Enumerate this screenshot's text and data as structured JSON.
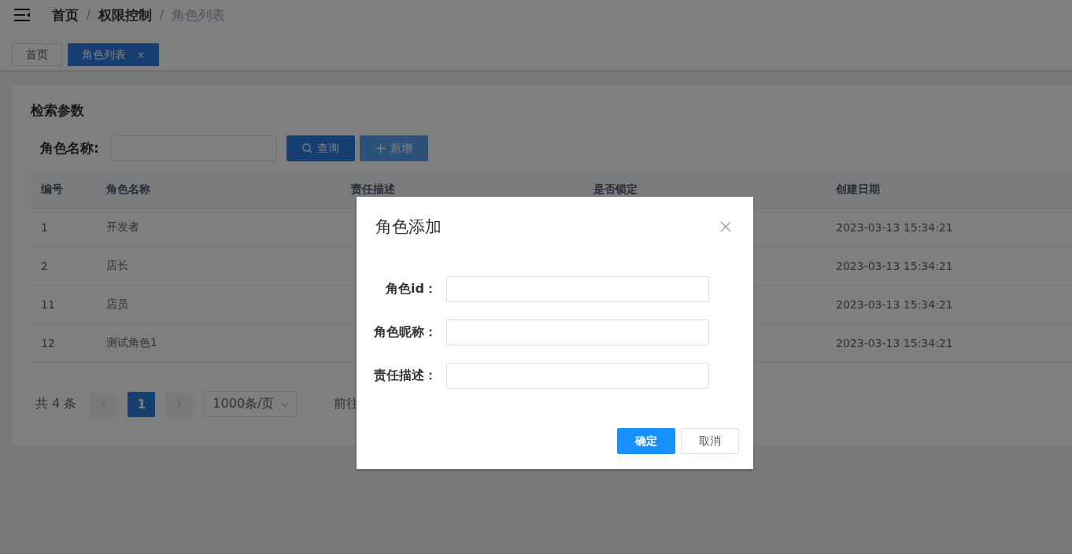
{
  "header": {
    "separator": "/",
    "breadcrumb": [
      {
        "label": "首页",
        "current": false
      },
      {
        "label": "权限控制",
        "current": false
      },
      {
        "label": "角色列表",
        "current": true
      }
    ]
  },
  "tabs": [
    {
      "label": "首页",
      "selected": false
    },
    {
      "label": "角色列表",
      "selected": true,
      "close_label": "×"
    }
  ],
  "search": {
    "title": "检索参数",
    "label": "角色名称:",
    "buttons": [
      {
        "label": "查询",
        "kind": "search"
      },
      {
        "label": "新增",
        "kind": "add"
      }
    ]
  },
  "table": {
    "columns": [
      "编号",
      "角色名称",
      "责任描述",
      "是否锁定",
      "创建日期"
    ],
    "rows": [
      {
        "id": "1",
        "name": "开发者",
        "created": "2023-03-13 15:34:21"
      },
      {
        "id": "2",
        "name": "店长",
        "created": "2023-03-13 15:34:21"
      },
      {
        "id": "11",
        "name": "店员",
        "created": "2023-03-13 15:34:21"
      },
      {
        "id": "12",
        "name": "测试角色1",
        "created": "2023-03-13 15:34:21"
      }
    ]
  },
  "pagination": {
    "total": "共 4 条",
    "prev": {
      "disabled": true
    },
    "pages": [
      {
        "label": "1",
        "selected": true
      }
    ],
    "next": {
      "disabled": true
    },
    "page_size": "1000条/页",
    "jump_label": "前往"
  },
  "dialog": {
    "title": "角色添加",
    "fields": [
      {
        "label": "角色id："
      },
      {
        "label": "角色昵称："
      },
      {
        "label": "责任描述："
      }
    ],
    "buttons": [
      {
        "label": "确定",
        "kind": "primary"
      },
      {
        "label": "取消",
        "kind": "default"
      }
    ]
  }
}
